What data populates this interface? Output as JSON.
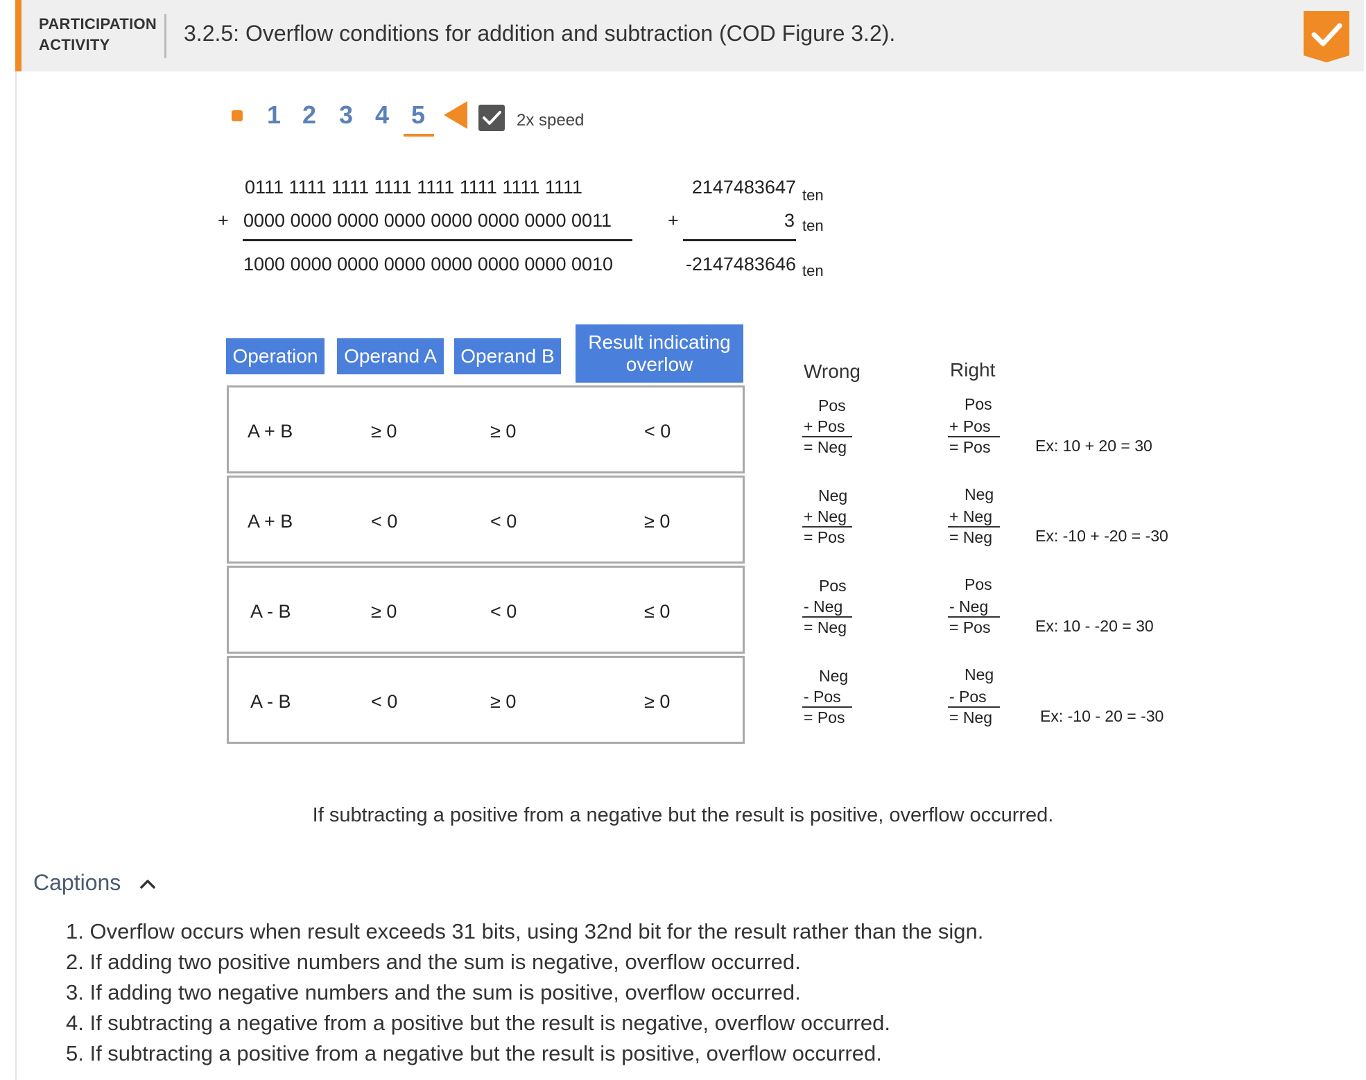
{
  "header": {
    "label_line1": "PARTICIPATION",
    "label_line2": "ACTIVITY",
    "title": "3.2.5: Overflow conditions for addition and subtraction (COD Figure 3.2).",
    "accent_color": "#f08a24"
  },
  "controls": {
    "steps": [
      "1",
      "2",
      "3",
      "4",
      "5"
    ],
    "current_step": "5",
    "speed_label": "2x speed",
    "speed_checked": true,
    "icons": [
      "stop-icon",
      "back-arrow-icon",
      "checkmark-icon"
    ]
  },
  "arithmetic": {
    "binary_a": "0111  1111  1111  1111  1111  1111  1111  1111",
    "binary_op": "+",
    "binary_b": "0000 0000 0000 0000 0000 0000 0000 0011",
    "binary_result": "1000 0000 0000 0000 0000 0000 0000 0010",
    "dec_a": "2147483647",
    "dec_op": "+",
    "dec_b": "3",
    "dec_result": "-2147483646",
    "base": "ten"
  },
  "table": {
    "headers": [
      "Operation",
      "Operand A",
      "Operand B",
      "Result indicating overlow"
    ],
    "header_color": "#4a7fdb",
    "rows": [
      {
        "op": "A + B",
        "a": "≥ 0",
        "b": "≥ 0",
        "result": "< 0"
      },
      {
        "op": "A + B",
        "a": "< 0",
        "b": "< 0",
        "result": "≥ 0"
      },
      {
        "op": "A - B",
        "a": "≥ 0",
        "b": "< 0",
        "result": "≤ 0"
      },
      {
        "op": "A - B",
        "a": "< 0",
        "b": "≥ 0",
        "result": "≥ 0"
      }
    ]
  },
  "comparison": {
    "wrong_label": "Wrong",
    "right_label": "Right",
    "rows": [
      {
        "wrong": [
          "Pos",
          "+ Pos",
          "= Neg"
        ],
        "right": [
          "Pos",
          "+ Pos",
          "= Pos"
        ],
        "example": "Ex: 10 + 20 = 30"
      },
      {
        "wrong": [
          "Neg",
          "+ Neg",
          "= Pos"
        ],
        "right": [
          "Neg",
          "+ Neg",
          "= Neg"
        ],
        "example": "Ex: -10 + -20 = -30"
      },
      {
        "wrong": [
          "Pos",
          "-  Neg",
          "= Neg"
        ],
        "right": [
          "Pos",
          "-  Neg",
          "= Pos"
        ],
        "example": "Ex: 10 - -20 = 30"
      },
      {
        "wrong": [
          "Neg",
          "-  Pos",
          "= Pos"
        ],
        "right": [
          "Neg",
          "-  Pos",
          "= Neg"
        ],
        "example": "Ex: -10 - 20 = -30"
      }
    ]
  },
  "caption_main": "If subtracting a positive from a negative but the result is positive, overflow occurred.",
  "captions": {
    "toggle_label": "Captions",
    "items": [
      "1. Overflow occurs when result exceeds 31 bits, using 32nd bit for the result rather than the sign.",
      "2. If adding two positive numbers and the sum is negative, overflow occurred.",
      "3. If adding two negative numbers and the sum is positive, overflow occurred.",
      "4. If subtracting a negative from a positive but the result is negative, overflow occurred.",
      "5. If subtracting a positive from a negative but the result is positive, overflow occurred."
    ]
  }
}
